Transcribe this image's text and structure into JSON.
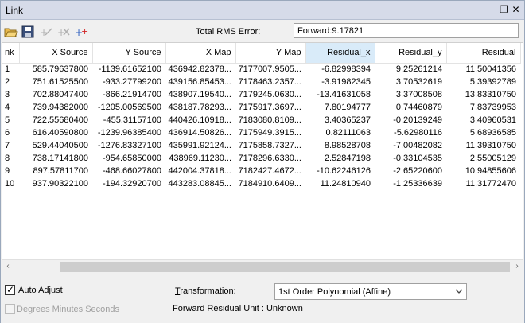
{
  "window": {
    "title": "Link",
    "restore_glyph": "❐",
    "close_glyph": "✕"
  },
  "toolbar": {
    "icons": [
      "open-folder-icon",
      "save-icon",
      "add-link-icon",
      "delete-link-icon",
      "add-control-point-icon"
    ],
    "rms_label": "Total RMS Error:",
    "rms_value": "Forward:9.17821"
  },
  "table": {
    "columns": [
      "nk",
      "X Source",
      "Y Source",
      "X Map",
      "Y Map",
      "Residual_x",
      "Residual_y",
      "Residual"
    ],
    "rows": [
      [
        "1",
        "585.79637800",
        "-1139.61652100",
        "436942.82378...",
        "7177007.9505...",
        "-6.82998394",
        "9.25261214",
        "11.50041356"
      ],
      [
        "2",
        "751.61525500",
        "-933.27799200",
        "439156.85453...",
        "7178463.2357...",
        "-3.91982345",
        "3.70532619",
        "5.39392789"
      ],
      [
        "3",
        "702.88047400",
        "-866.21914700",
        "438907.19540...",
        "7179245.0630...",
        "-13.41631058",
        "3.37008508",
        "13.83310750"
      ],
      [
        "4",
        "739.94382000",
        "-1205.00569500",
        "438187.78293...",
        "7175917.3697...",
        "7.80194777",
        "0.74460879",
        "7.83739953"
      ],
      [
        "5",
        "722.55680400",
        "-455.31157100",
        "440426.10918...",
        "7183080.8109...",
        "3.40365237",
        "-0.20139249",
        "3.40960531"
      ],
      [
        "6",
        "616.40590800",
        "-1239.96385400",
        "436914.50826...",
        "7175949.3915...",
        "0.82111063",
        "-5.62980116",
        "5.68936585"
      ],
      [
        "7",
        "529.44040500",
        "-1276.83327100",
        "435991.92124...",
        "7175858.7327...",
        "8.98528708",
        "-7.00482082",
        "11.39310750"
      ],
      [
        "8",
        "738.17141800",
        "-954.65850000",
        "438969.11230...",
        "7178296.6330...",
        "2.52847198",
        "-0.33104535",
        "2.55005129"
      ],
      [
        "9",
        "897.57811700",
        "-468.66027800",
        "442004.37818...",
        "7182427.4672...",
        "-10.62246126",
        "-2.65220600",
        "10.94855606"
      ],
      [
        "10",
        "937.90322100",
        "-194.32920700",
        "443283.08845...",
        "7184910.6409...",
        "11.24810940",
        "-1.25336639",
        "11.31772470"
      ]
    ]
  },
  "options": {
    "auto_adjust": {
      "label_u": "A",
      "label_rest": "uto Adjust",
      "checked": true,
      "check_glyph": "✓"
    },
    "degrees": {
      "label": "Degrees Minutes Seconds",
      "checked": false
    },
    "transformation": {
      "label_u": "T",
      "label_rest": "ransformation:",
      "value": "1st Order Polynomial (Affine)"
    },
    "residual_unit": "Forward Residual Unit : Unknown"
  },
  "scrollbar": {
    "left_glyph": "‹",
    "right_glyph": "›"
  }
}
